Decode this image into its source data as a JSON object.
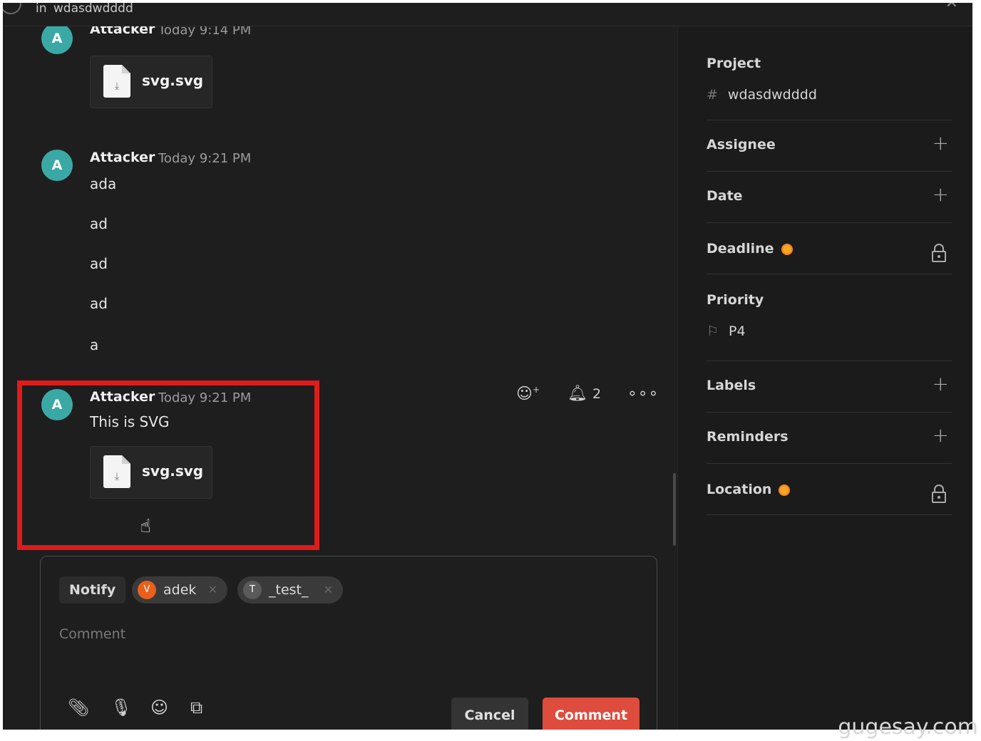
{
  "topbar": {
    "context_prefix": "in",
    "project": "wdasdwdddd"
  },
  "comments": [
    {
      "author": "Attacker",
      "avatar_letter": "A",
      "time": "Today 9:14 PM",
      "attachment": "svg.svg"
    },
    {
      "author": "Attacker",
      "avatar_letter": "A",
      "time": "Today 9:21 PM",
      "lines": [
        "ada",
        "ad",
        "ad",
        "ad",
        "a"
      ]
    },
    {
      "author": "Attacker",
      "avatar_letter": "A",
      "time": "Today 9:21 PM",
      "text": "This is SVG",
      "attachment": "svg.svg"
    }
  ],
  "comment_actions": {
    "reaction_icon": "add-reaction-icon",
    "subscribers_count": "2",
    "more_icon": "more-icon"
  },
  "composer": {
    "notify_label": "Notify",
    "recipients": [
      {
        "initial": "V",
        "name": "adek",
        "color": "#e8601c"
      },
      {
        "initial": "T",
        "name": "_test_",
        "color": "#5a5a5a"
      }
    ],
    "placeholder": "Comment",
    "cancel_label": "Cancel",
    "comment_label": "Comment"
  },
  "sidebar": {
    "project_label": "Project",
    "project_value": "wdasdwdddd",
    "assignee_label": "Assignee",
    "date_label": "Date",
    "deadline_label": "Deadline",
    "priority_label": "Priority",
    "priority_value": "P4",
    "labels_label": "Labels",
    "reminders_label": "Reminders",
    "location_label": "Location"
  },
  "colors": {
    "accent": "#de4c3e",
    "avatar": "#3aa9a6",
    "highlight_box": "#e01b1b",
    "upgrade_dot": "#f5a623"
  },
  "watermark": "gugesay.com"
}
